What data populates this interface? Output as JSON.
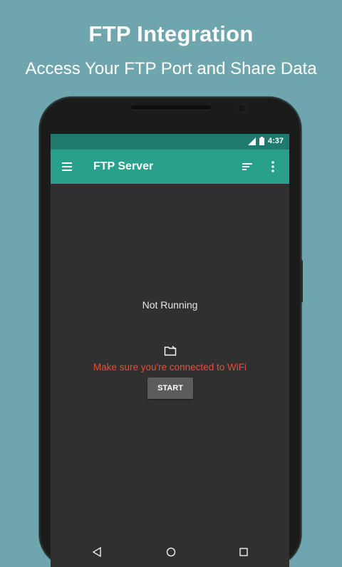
{
  "promo": {
    "headline": "FTP Integration",
    "subline": "Access Your FTP Port and Share Data"
  },
  "status_bar": {
    "time": "4:37",
    "icons": [
      "signal-icon",
      "battery-icon"
    ]
  },
  "app_bar": {
    "title": "FTP Server",
    "icons": [
      "menu-icon",
      "sort-icon",
      "more-vert-icon"
    ]
  },
  "server": {
    "state": "Not Running",
    "status_icon": "folder-icon",
    "message": "Make sure you're connected to WiFi",
    "start_label": "START"
  },
  "nav_bar": {
    "icons": [
      "back-icon",
      "home-icon",
      "recent-apps-icon"
    ]
  },
  "colors": {
    "background": "#6fa6ae",
    "status_bar": "#1e7b6d",
    "app_bar": "#27a08c",
    "screen": "#303030",
    "warning_text": "#e84c3d",
    "button": "#5c5c5c"
  }
}
